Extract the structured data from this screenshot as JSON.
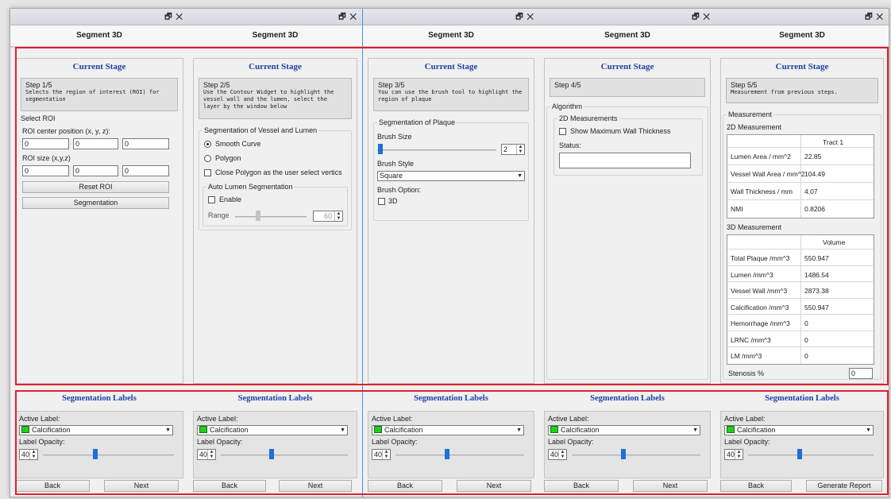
{
  "tab_title": "Segment 3D",
  "stage_header": "Current Stage",
  "labels_header": "Segmentation Labels",
  "active_label": "Active Label:",
  "label_value": "Calcification",
  "label_opacity": "Label Opacity:",
  "opacity_value": "40",
  "back": "Back",
  "next": "Next",
  "generate_report": "Generate Report",
  "p1": {
    "step": "Step 1/5",
    "desc": "Selects the region of interest (ROI) for segmentation",
    "group": "Select ROI",
    "center_label": "ROI center position (x, y, z):",
    "center": [
      "0",
      "0",
      "0"
    ],
    "size_label": "ROI size (x,y,z)",
    "size": [
      "0",
      "0",
      "0"
    ],
    "reset": "Reset ROI",
    "segment": "Segmentation"
  },
  "p2": {
    "step": "Step 2/5",
    "desc": "Use the Contour Widget to highlight the vessel wall and the lumen, select the layer by the window below",
    "group": "Segmentation of Vessel and Lumen",
    "smooth": "Smooth Curve",
    "polygon": "Polygon",
    "close_poly": "Close Polygon as the user select vertics",
    "auto": "Auto Lumen Segmentation",
    "enable": "Enable",
    "range": "Range",
    "range_value": "60"
  },
  "p3": {
    "step": "Step 3/5",
    "desc": "You can use the brush tool to highlight the region of plaque",
    "group": "Segmentation of Plaque",
    "brush_size": "Brush Size",
    "brush_value": "2",
    "brush_style": "Brush Style",
    "style_value": "Square",
    "brush_option": "Brush Option:",
    "opt3d": "3D"
  },
  "p4": {
    "step": "Step 4/5",
    "algorithm": "Algorithm",
    "m2d": "2D Measurements",
    "show_max": "Show Maximum Wall Thickness",
    "status": "Status:"
  },
  "p5": {
    "step": "Step 5/5",
    "desc": "Measurement from previous steps.",
    "measurement": "Measurement",
    "m2d": "2D Measurement",
    "t2_header": "Tract 1",
    "t2": [
      [
        "Lumen Area / mm^2",
        "22.85"
      ],
      [
        "Vessel Wall Area / mm^2",
        "104.49"
      ],
      [
        "Wall Thickness / mm",
        "4.07"
      ],
      [
        "NMI",
        "0.8206"
      ]
    ],
    "m3d": "3D Measurement",
    "t3_header": "Volume",
    "t3": [
      [
        "Total Plaque /mm^3",
        "550.947"
      ],
      [
        "Lumen /mm^3",
        "1486.54"
      ],
      [
        "Vessel Wall /mm^3",
        "2873.38"
      ],
      [
        "Calcification /mm^3",
        "550.947"
      ],
      [
        "Hemorrhage /mm^3",
        "0"
      ],
      [
        "LRNC /mm^3",
        "0"
      ],
      [
        "LM /mm^3",
        "0"
      ]
    ],
    "stenosis": "Stenosis %",
    "stenosis_value": "0"
  }
}
